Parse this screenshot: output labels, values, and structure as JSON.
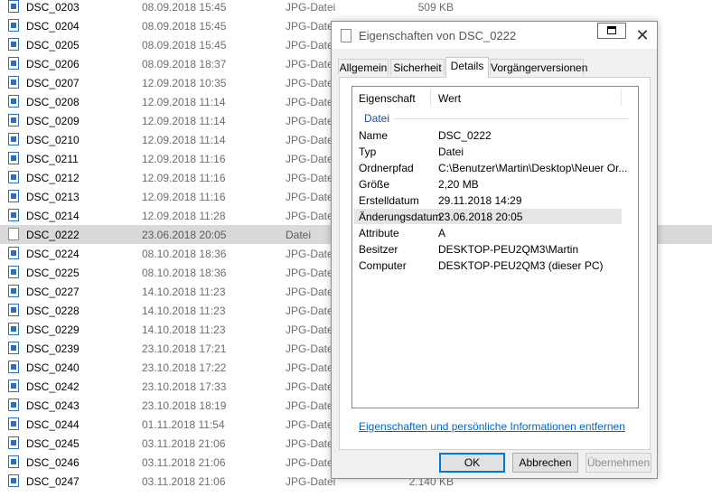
{
  "files": [
    {
      "name": "DSC_0203",
      "date": "08.09.2018 15:45",
      "type": "JPG-Datei",
      "size": "509 KB",
      "icon": "jpg"
    },
    {
      "name": "DSC_0204",
      "date": "08.09.2018 15:45",
      "type": "JPG-Datei",
      "size": "",
      "icon": "jpg"
    },
    {
      "name": "DSC_0205",
      "date": "08.09.2018 15:45",
      "type": "JPG-Datei",
      "size": "",
      "icon": "jpg"
    },
    {
      "name": "DSC_0206",
      "date": "08.09.2018 18:37",
      "type": "JPG-Datei",
      "size": "",
      "icon": "jpg"
    },
    {
      "name": "DSC_0207",
      "date": "12.09.2018 10:35",
      "type": "JPG-Datei",
      "size": "",
      "icon": "jpg"
    },
    {
      "name": "DSC_0208",
      "date": "12.09.2018 11:14",
      "type": "JPG-Datei",
      "size": "",
      "icon": "jpg"
    },
    {
      "name": "DSC_0209",
      "date": "12.09.2018 11:14",
      "type": "JPG-Datei",
      "size": "",
      "icon": "jpg"
    },
    {
      "name": "DSC_0210",
      "date": "12.09.2018 11:14",
      "type": "JPG-Datei",
      "size": "",
      "icon": "jpg"
    },
    {
      "name": "DSC_0211",
      "date": "12.09.2018 11:16",
      "type": "JPG-Datei",
      "size": "",
      "icon": "jpg"
    },
    {
      "name": "DSC_0212",
      "date": "12.09.2018 11:16",
      "type": "JPG-Datei",
      "size": "",
      "icon": "jpg"
    },
    {
      "name": "DSC_0213",
      "date": "12.09.2018 11:16",
      "type": "JPG-Datei",
      "size": "",
      "icon": "jpg"
    },
    {
      "name": "DSC_0214",
      "date": "12.09.2018 11:28",
      "type": "JPG-Datei",
      "size": "",
      "icon": "jpg"
    },
    {
      "name": "DSC_0222",
      "date": "23.06.2018 20:05",
      "type": "Datei",
      "size": "",
      "icon": "blank",
      "selected": true
    },
    {
      "name": "DSC_0224",
      "date": "08.10.2018 18:36",
      "type": "JPG-Datei",
      "size": "",
      "icon": "jpg"
    },
    {
      "name": "DSC_0225",
      "date": "08.10.2018 18:36",
      "type": "JPG-Datei",
      "size": "",
      "icon": "jpg"
    },
    {
      "name": "DSC_0227",
      "date": "14.10.2018 11:23",
      "type": "JPG-Datei",
      "size": "",
      "icon": "jpg"
    },
    {
      "name": "DSC_0228",
      "date": "14.10.2018 11:23",
      "type": "JPG-Datei",
      "size": "",
      "icon": "jpg"
    },
    {
      "name": "DSC_0229",
      "date": "14.10.2018 11:23",
      "type": "JPG-Datei",
      "size": "",
      "icon": "jpg"
    },
    {
      "name": "DSC_0239",
      "date": "23.10.2018 17:21",
      "type": "JPG-Datei",
      "size": "",
      "icon": "jpg"
    },
    {
      "name": "DSC_0240",
      "date": "23.10.2018 17:22",
      "type": "JPG-Datei",
      "size": "",
      "icon": "jpg"
    },
    {
      "name": "DSC_0242",
      "date": "23.10.2018 17:33",
      "type": "JPG-Datei",
      "size": "",
      "icon": "jpg"
    },
    {
      "name": "DSC_0243",
      "date": "23.10.2018 18:19",
      "type": "JPG-Datei",
      "size": "",
      "icon": "jpg"
    },
    {
      "name": "DSC_0244",
      "date": "01.11.2018 11:54",
      "type": "JPG-Datei",
      "size": "",
      "icon": "jpg"
    },
    {
      "name": "DSC_0245",
      "date": "03.11.2018 21:06",
      "type": "JPG-Datei",
      "size": "",
      "icon": "jpg"
    },
    {
      "name": "DSC_0246",
      "date": "03.11.2018 21:06",
      "type": "JPG-Datei",
      "size": "",
      "icon": "jpg"
    },
    {
      "name": "DSC_0247",
      "date": "03.11.2018 21:06",
      "type": "JPG-Datei",
      "size": "2.140 KB",
      "icon": "jpg"
    }
  ],
  "dialog": {
    "title": "Eigenschaften von DSC_0222",
    "tabs": [
      "Allgemein",
      "Sicherheit",
      "Details",
      "Vorgängerversionen"
    ],
    "active_tab": "Details",
    "columns": {
      "property": "Eigenschaft",
      "value": "Wert"
    },
    "group": "Datei",
    "properties": [
      {
        "key": "Name",
        "value": "DSC_0222"
      },
      {
        "key": "Typ",
        "value": "Datei"
      },
      {
        "key": "Ordnerpfad",
        "value": "C:\\Benutzer\\Martin\\Desktop\\Neuer Or..."
      },
      {
        "key": "Größe",
        "value": "2,20 MB"
      },
      {
        "key": "Erstelldatum",
        "value": "29.11.2018 14:29"
      },
      {
        "key": "Änderungsdatum",
        "value": "23.06.2018 20:05",
        "highlight": true
      },
      {
        "key": "Attribute",
        "value": "A"
      },
      {
        "key": "Besitzer",
        "value": "DESKTOP-PEU2QM3\\Martin"
      },
      {
        "key": "Computer",
        "value": "DESKTOP-PEU2QM3 (dieser PC)"
      }
    ],
    "remove_link": "Eigenschaften und persönliche Informationen entfernen",
    "buttons": {
      "ok": "OK",
      "cancel": "Abbrechen",
      "apply": "Übernehmen"
    },
    "close_glyph": "✕"
  }
}
